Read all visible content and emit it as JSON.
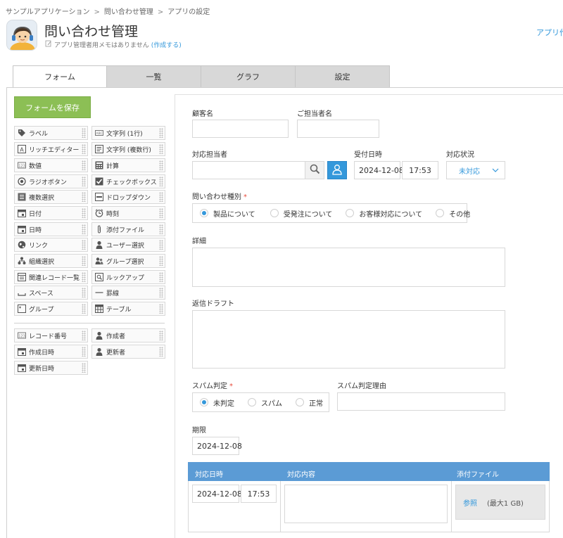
{
  "breadcrumb": [
    "サンプルアプリケーション",
    "問い合わせ管理",
    "アプリの設定"
  ],
  "breadcrumb_sep": ">",
  "app": {
    "title": "問い合わせ管理",
    "memo": "アプリ管理者用メモはありません",
    "memo_link": "(作成する)",
    "top_right_link": "アプリ作"
  },
  "tabs": [
    "フォーム",
    "一覧",
    "グラフ",
    "設定"
  ],
  "save_button": "フォームを保存",
  "palette": {
    "left": [
      {
        "label": "ラベル",
        "icon": "tag-icon"
      },
      {
        "label": "リッチエディター",
        "icon": "rich-editor-icon"
      },
      {
        "label": "数値",
        "icon": "number-icon"
      },
      {
        "label": "ラジオボタン",
        "icon": "radio-icon"
      },
      {
        "label": "複数選択",
        "icon": "multi-select-icon"
      },
      {
        "label": "日付",
        "icon": "calendar-icon"
      },
      {
        "label": "日時",
        "icon": "calendar-icon"
      },
      {
        "label": "リンク",
        "icon": "globe-icon"
      },
      {
        "label": "組織選択",
        "icon": "org-icon"
      },
      {
        "label": "関連レコード一覧",
        "icon": "related-records-icon"
      },
      {
        "label": "スペース",
        "icon": "space-icon"
      },
      {
        "label": "グループ",
        "icon": "group-field-icon"
      }
    ],
    "right": [
      {
        "label": "文字列 (1行)",
        "icon": "text-single-icon"
      },
      {
        "label": "文字列 (複数行)",
        "icon": "text-multi-icon"
      },
      {
        "label": "計算",
        "icon": "calculator-icon"
      },
      {
        "label": "チェックボックス",
        "icon": "checkbox-icon"
      },
      {
        "label": "ドロップダウン",
        "icon": "dropdown-icon"
      },
      {
        "label": "時刻",
        "icon": "clock-icon"
      },
      {
        "label": "添付ファイル",
        "icon": "paperclip-icon"
      },
      {
        "label": "ユーザー選択",
        "icon": "user-icon"
      },
      {
        "label": "グループ選択",
        "icon": "users-icon"
      },
      {
        "label": "ルックアップ",
        "icon": "lookup-icon"
      },
      {
        "label": "罫線",
        "icon": "line-icon"
      },
      {
        "label": "テーブル",
        "icon": "table-icon"
      }
    ],
    "system_left": [
      {
        "label": "レコード番号",
        "icon": "number-icon"
      },
      {
        "label": "作成日時",
        "icon": "calendar-icon"
      },
      {
        "label": "更新日時",
        "icon": "calendar-icon"
      }
    ],
    "system_right": [
      {
        "label": "作成者",
        "icon": "user-icon"
      },
      {
        "label": "更新者",
        "icon": "user-icon"
      }
    ]
  },
  "form": {
    "customer_name": "顧客名",
    "contact_person": "ご担当者名",
    "assignee": "対応担当者",
    "received_at": "受付日時",
    "received_date": "2024-12-08",
    "received_time": "17:53",
    "status_label": "対応状況",
    "status_value": "未対応",
    "inquiry_type_label": "問い合わせ種別",
    "required_mark": "*",
    "inquiry_types": [
      "製品について",
      "受発注について",
      "お客様対応について",
      "その他"
    ],
    "inquiry_selected": 0,
    "details_label": "詳細",
    "reply_draft_label": "返信ドラフト",
    "spam_label": "スパム判定",
    "spam_options": [
      "未判定",
      "スパム",
      "正常"
    ],
    "spam_selected": 0,
    "spam_reason_label": "スパム判定理由",
    "deadline_label": "期限",
    "deadline_value": "2024-12-08"
  },
  "subtable": {
    "headers": [
      "対応日時",
      "対応内容",
      "添付ファイル"
    ],
    "row_date": "2024-12-08",
    "row_time": "17:53",
    "browse": "参照",
    "max_size": "(最大1 GB)"
  },
  "colors": {
    "accent": "#3498db",
    "save_button": "#8cbf55",
    "table_header": "#5b9bd5",
    "required": "#e74c3c"
  }
}
